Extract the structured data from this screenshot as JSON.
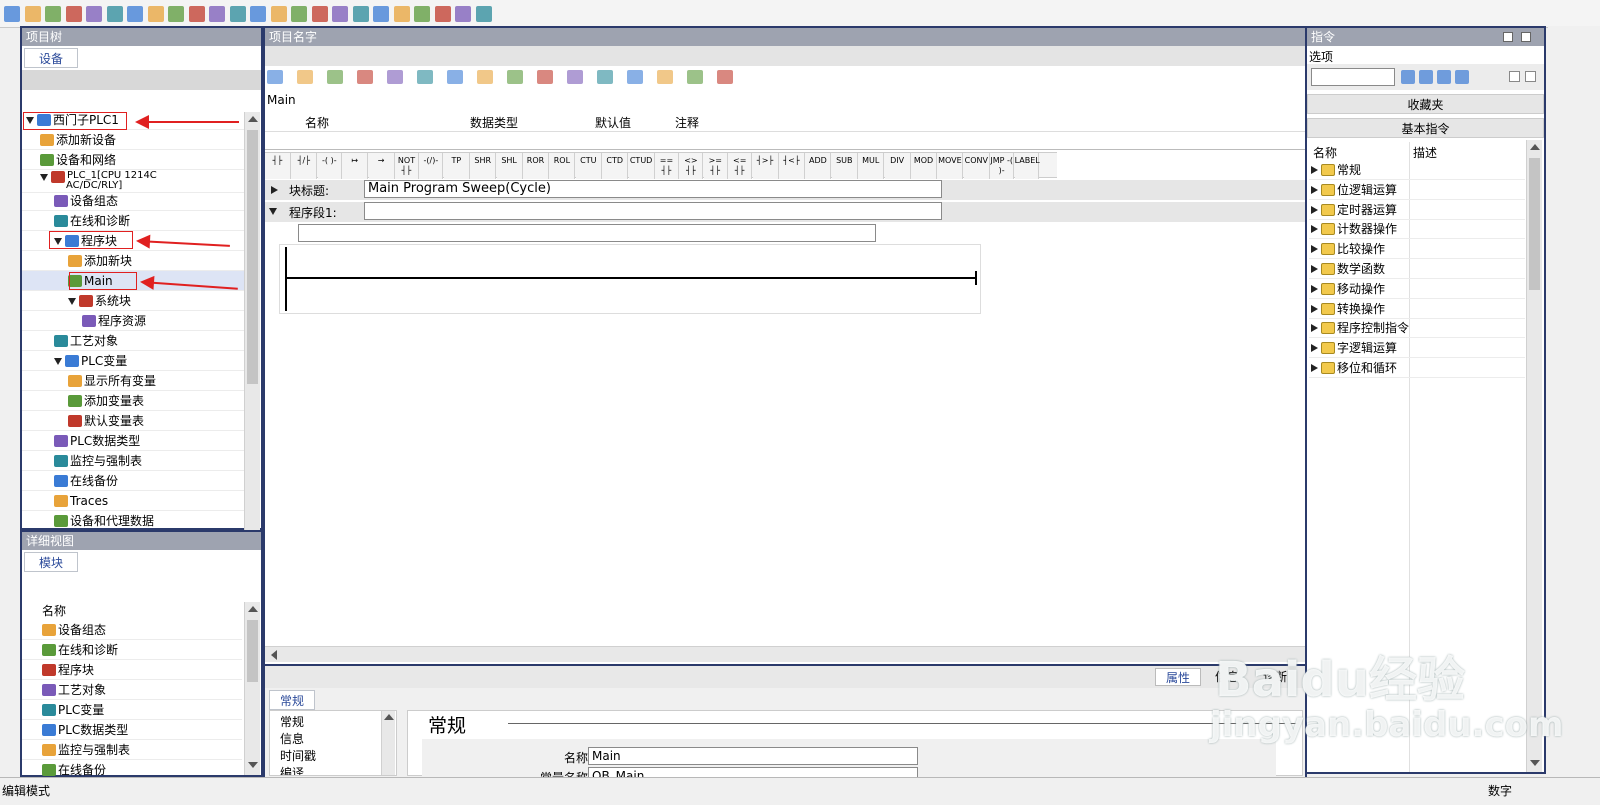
{
  "toolbar": {
    "icons": [
      "new-project-icon",
      "open-project-icon",
      "save-project-icon",
      "print-icon",
      "cut-icon",
      "copy-icon",
      "paste-icon",
      "delete-icon",
      "undo-icon",
      "redo-icon",
      "compile-icon",
      "download-icon",
      "upload-icon",
      "simulation-icon",
      "start-runtime-icon",
      "go-online-icon",
      "go-offline-icon",
      "accessible-devices-icon",
      "start-cpu-icon",
      "stop-cpu-icon",
      "close-icon",
      "split-horizontal-icon",
      "split-vertical-icon",
      "network-icon"
    ]
  },
  "project_tree": {
    "title": "项目树",
    "tab": "设备",
    "items": [
      {
        "label": "西门子PLC1",
        "level": 0,
        "expanded": true,
        "icon": "plc-device-icon"
      },
      {
        "label": "添加新设备",
        "level": 1,
        "icon": "add-device-icon"
      },
      {
        "label": "设备和网络",
        "level": 1,
        "icon": "network-icon"
      },
      {
        "label": "PLC_1[CPU 1214C",
        "label2": "AC/DC/RLY]",
        "level": 1,
        "expanded": true,
        "icon": "cpu-icon"
      },
      {
        "label": "设备组态",
        "level": 2,
        "icon": "device-config-icon"
      },
      {
        "label": "在线和诊断",
        "level": 2,
        "icon": "online-diag-icon"
      },
      {
        "label": "程序块",
        "level": 2,
        "expanded": true,
        "icon": "program-block-icon"
      },
      {
        "label": "添加新块",
        "level": 3,
        "icon": "add-block-icon"
      },
      {
        "label": "Main",
        "level": 3,
        "icon": "main-ob-icon"
      },
      {
        "label": "系统块",
        "level": 3,
        "expanded": true,
        "icon": "system-block-icon"
      },
      {
        "label": "程序资源",
        "level": 4,
        "icon": "program-resource-icon"
      },
      {
        "label": "工艺对象",
        "level": 2,
        "icon": "tech-object-icon"
      },
      {
        "label": "PLC变量",
        "level": 2,
        "expanded": true,
        "icon": "plc-tag-icon"
      },
      {
        "label": "显示所有变量",
        "level": 3,
        "icon": "show-tags-icon"
      },
      {
        "label": "添加变量表",
        "level": 3,
        "icon": "add-tag-table-icon"
      },
      {
        "label": "默认变量表",
        "level": 3,
        "icon": "default-tag-table-icon"
      },
      {
        "label": "PLC数据类型",
        "level": 2,
        "icon": "plc-datatype-icon"
      },
      {
        "label": "监控与强制表",
        "level": 2,
        "icon": "watch-table-icon"
      },
      {
        "label": "在线备份",
        "level": 2,
        "icon": "online-backup-icon"
      },
      {
        "label": "Traces",
        "level": 2,
        "icon": "traces-icon"
      },
      {
        "label": "设备和代理数据",
        "level": 2,
        "icon": "proxy-data-icon"
      }
    ]
  },
  "detail_view": {
    "title": "详细视图",
    "tab": "模块",
    "column": "名称",
    "items": [
      {
        "label": "设备组态",
        "icon": "device-config-icon"
      },
      {
        "label": "在线和诊断",
        "icon": "online-diag-icon"
      },
      {
        "label": "程序块",
        "icon": "program-block-icon"
      },
      {
        "label": "工艺对象",
        "icon": "tech-object-icon"
      },
      {
        "label": "PLC变量",
        "icon": "plc-tag-icon"
      },
      {
        "label": "PLC数据类型",
        "icon": "plc-datatype-icon"
      },
      {
        "label": "监控与强制表",
        "icon": "watch-table-icon"
      },
      {
        "label": "在线备份",
        "icon": "online-backup-icon"
      }
    ]
  },
  "editor": {
    "title": "项目名字",
    "block_name": "Main",
    "interface_columns": [
      "名称",
      "数据类型",
      "默认值",
      "注释"
    ],
    "ladder_tools": [
      "┤├",
      "┤/├",
      "-( )-",
      "↦",
      "→",
      "NOT ┤├",
      "-(/)-",
      "TP",
      "SHR",
      "SHL",
      "ROR",
      "ROL",
      "CTU",
      "CTD",
      "CTUD",
      "== ┤├",
      "<> ┤├",
      ">= ┤├",
      "<= ┤├",
      "┤>├",
      "┤<├",
      "ADD",
      "SUB",
      "MUL",
      "DIV",
      "MOD",
      "MOVE",
      "CONV",
      "JMP -( )-",
      "LABEL"
    ],
    "block_title_label": "块标题:",
    "block_title_value": "Main Program Sweep(Cycle)",
    "network_label": "程序段1:",
    "network_value": "",
    "network_comment": ""
  },
  "properties": {
    "tabs": [
      "属性",
      "信息",
      "诊断"
    ],
    "active_tab": "常规",
    "nav": [
      "常规",
      "信息",
      "时间戳",
      "编译"
    ],
    "section_title": "常规",
    "fields": [
      {
        "label": "名称:",
        "value": "Main"
      },
      {
        "label": "常量名称:",
        "value": "OB_Main"
      }
    ]
  },
  "instructions": {
    "title": "指令",
    "options_label": "选项",
    "search_value": "",
    "favorites": "收藏夹",
    "basic": "基本指令",
    "columns": [
      "名称",
      "描述"
    ],
    "items": [
      {
        "label": "常规",
        "icon": "folder-icon"
      },
      {
        "label": "位逻辑运算",
        "icon": "bit-logic-icon"
      },
      {
        "label": "定时器运算",
        "icon": "timer-icon"
      },
      {
        "label": "计数器操作",
        "icon": "counter-icon"
      },
      {
        "label": "比较操作",
        "icon": "compare-icon"
      },
      {
        "label": "数学函数",
        "icon": "math-icon"
      },
      {
        "label": "移动操作",
        "icon": "move-icon"
      },
      {
        "label": "转换操作",
        "icon": "convert-icon"
      },
      {
        "label": "程序控制指令",
        "icon": "program-control-icon"
      },
      {
        "label": "字逻辑运算",
        "icon": "word-logic-icon"
      },
      {
        "label": "移位和循环",
        "icon": "shift-rotate-icon"
      }
    ]
  },
  "status_bar": {
    "mode": "编辑模式",
    "input_mode": "数字"
  },
  "watermark": {
    "brand": "Baidu经验",
    "url": "jingyan.baidu.com"
  },
  "colors": {
    "accent": "#2b3a6b",
    "title_bar": "#9ea3b0",
    "highlight": "#e02020",
    "selection": "#dde4f5"
  }
}
